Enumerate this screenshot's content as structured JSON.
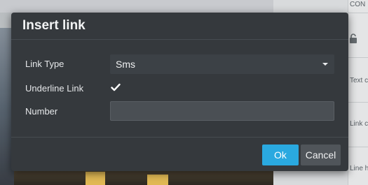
{
  "dialog": {
    "title": "Insert link",
    "fields": {
      "link_type": {
        "label": "Link Type",
        "value": "Sms"
      },
      "underline": {
        "label": "Underline Link",
        "checked": true
      },
      "number": {
        "label": "Number",
        "value": "",
        "placeholder": ""
      }
    },
    "buttons": {
      "ok": "Ok",
      "cancel": "Cancel"
    }
  },
  "background_panel": {
    "header_fragment": "CON",
    "row_fragments": [
      "Text c",
      "Link c",
      "Line h"
    ]
  },
  "colors": {
    "dialog_bg": "#35393d",
    "ok_button": "#2aa9e0",
    "cancel_button": "#50555a"
  }
}
